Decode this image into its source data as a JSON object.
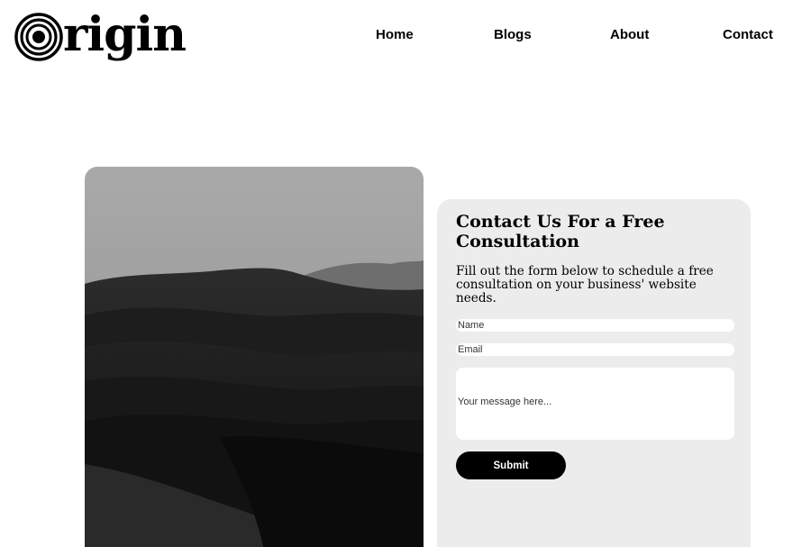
{
  "brand": {
    "logo_text": "rigin",
    "logo_icon": "concentric-circles-icon"
  },
  "nav": {
    "items": [
      {
        "label": "Home"
      },
      {
        "label": "Blogs"
      },
      {
        "label": "About"
      },
      {
        "label": "Contact"
      }
    ]
  },
  "hero": {
    "image": "black-and-white desert dunes"
  },
  "contact": {
    "title": "Contact Us For a Free Consultation",
    "description": "Fill out the form below to schedule a free consultation on your business' website needs.",
    "name_placeholder": "Name",
    "email_placeholder": "Email",
    "message_placeholder": "Your message here...",
    "submit_label": "Submit"
  }
}
